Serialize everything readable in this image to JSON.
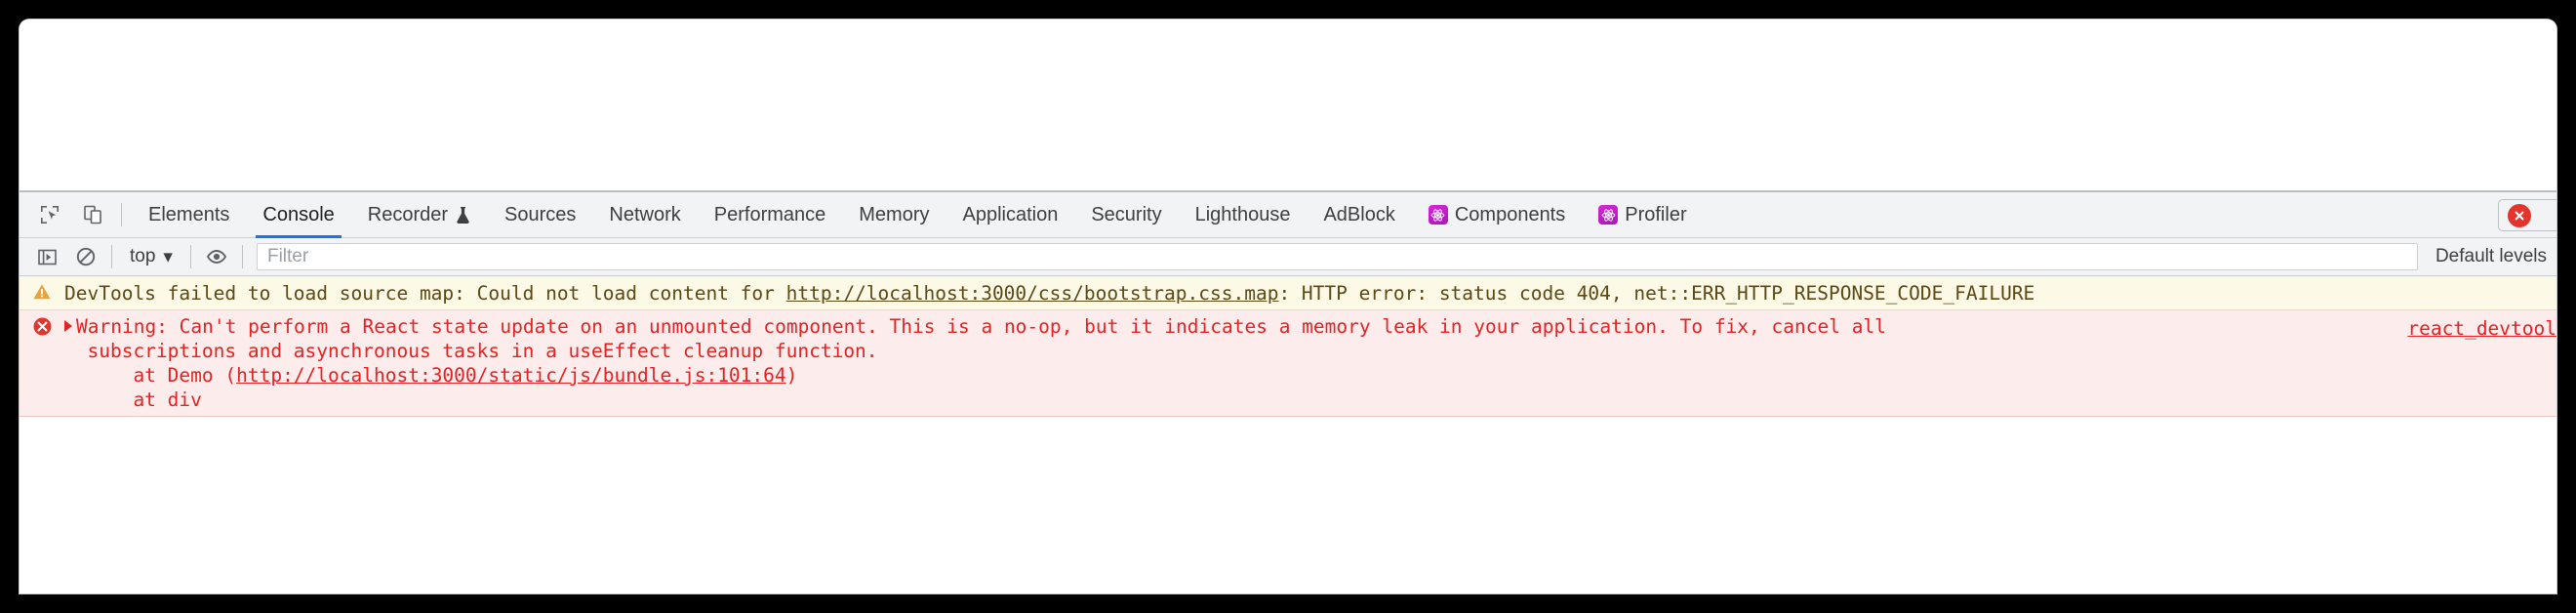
{
  "devtools": {
    "toolbar_icons": [
      {
        "name": "inspect-element-icon",
        "title": "Inspect element"
      },
      {
        "name": "device-toolbar-icon",
        "title": "Toggle device toolbar"
      }
    ],
    "tabs": [
      {
        "label": "Elements",
        "active": false,
        "icon": null
      },
      {
        "label": "Console",
        "active": true,
        "icon": null
      },
      {
        "label": "Recorder",
        "active": false,
        "icon": "flask-icon"
      },
      {
        "label": "Sources",
        "active": false,
        "icon": null
      },
      {
        "label": "Network",
        "active": false,
        "icon": null
      },
      {
        "label": "Performance",
        "active": false,
        "icon": null
      },
      {
        "label": "Memory",
        "active": false,
        "icon": null
      },
      {
        "label": "Application",
        "active": false,
        "icon": null
      },
      {
        "label": "Security",
        "active": false,
        "icon": null
      },
      {
        "label": "Lighthouse",
        "active": false,
        "icon": null
      },
      {
        "label": "AdBlock",
        "active": false,
        "icon": null
      },
      {
        "label": "Components",
        "active": false,
        "icon": "react-atom-icon"
      },
      {
        "label": "Profiler",
        "active": false,
        "icon": "react-atom-icon"
      }
    ],
    "error_badge": {
      "name": "error-count-badge",
      "icon": "error-circle-icon"
    }
  },
  "console_toolbar": {
    "sidebar_toggle": "console-sidebar-toggle-icon",
    "clear_console": "clear-console-icon",
    "context": "top",
    "context_caret": "▾",
    "live_expression": "eye-icon",
    "filter": {
      "placeholder": "Filter",
      "value": ""
    },
    "levels": "Default levels"
  },
  "messages": [
    {
      "type": "warning",
      "icon": "warning-triangle-icon",
      "segments": [
        {
          "text": "DevTools failed to load source map: Could not load content for ",
          "link": false
        },
        {
          "text": "http://localhost:3000/css/bootstrap.css.map",
          "link": true
        },
        {
          "text": ": HTTP error: status code 404, net::ERR_HTTP_RESPONSE_CODE_FAILURE",
          "link": false
        }
      ]
    },
    {
      "type": "error",
      "icon": "error-circle-icon",
      "expandable": true,
      "lines": [
        {
          "segments": [
            {
              "text": "Warning: Can't perform a React state update on an unmounted component. This is a no-op, but it indicates a memory leak in your application. To fix, cancel all",
              "link": false
            }
          ]
        },
        {
          "segments": [
            {
              "text": "  subscriptions and asynchronous tasks in a useEffect cleanup function.",
              "link": false
            }
          ]
        },
        {
          "segments": [
            {
              "text": "      at Demo (",
              "link": false
            },
            {
              "text": "http://localhost:3000/static/js/bundle.js:101:64",
              "link": true
            },
            {
              "text": ")",
              "link": false
            }
          ]
        },
        {
          "segments": [
            {
              "text": "      at div",
              "link": false
            }
          ]
        }
      ],
      "source_link": "react_devtool"
    }
  ],
  "colors": {
    "accent": "#1a73e8",
    "toolbar_bg": "#f1f3f4",
    "warning_bg": "#fdf9e7",
    "warning_text": "#5c4813",
    "error_bg": "#fdecec",
    "error_text": "#e52222",
    "react_purple": "#d827d8"
  }
}
